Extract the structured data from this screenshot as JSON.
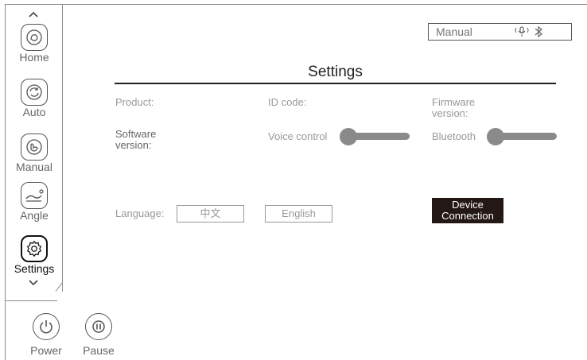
{
  "sidebar": {
    "items": [
      {
        "label": "Home",
        "icon": "home-hand-icon"
      },
      {
        "label": "Auto",
        "icon": "auto-cycle-icon"
      },
      {
        "label": "Manual",
        "icon": "manual-hand-icon"
      },
      {
        "label": "Angle",
        "icon": "angle-recline-icon"
      },
      {
        "label": "Settings",
        "icon": "gear-icon",
        "active": true
      }
    ]
  },
  "bottom": {
    "power_label": "Power",
    "pause_label": "Pause"
  },
  "status": {
    "mode": "Manual",
    "icons": [
      "voice-icon",
      "bluetooth-icon"
    ]
  },
  "settings": {
    "title": "Settings",
    "product_label": "Product:",
    "id_code_label": "ID code:",
    "firmware_label": "Firmware\nversion:",
    "software_label": "Software\nversion:",
    "voice_control_label": "Voice control",
    "bluetooth_label": "Bluetooth",
    "language_label": "Language:",
    "language_options": [
      "中文",
      "English"
    ],
    "device_connection_label": "Device\nConnection"
  },
  "colors": {
    "accent_dark": "#231815",
    "toggle_off": "#8a8a8a",
    "muted_text": "#999999"
  }
}
